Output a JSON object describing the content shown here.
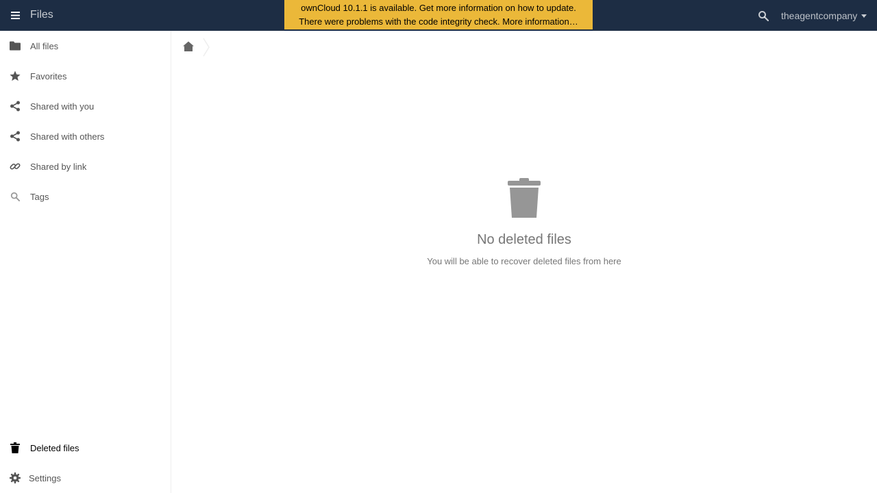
{
  "header": {
    "app_title": "Files",
    "menu_icon": "hamburger-icon",
    "notices": {
      "update": "ownCloud 10.1.1 is available. Get more information on how to update.",
      "integrity": "There were problems with the code integrity check. More information…"
    },
    "search_icon": "search-icon",
    "user": "theagentcompany",
    "bg_color": "#1d2d44",
    "notice_color": "#ebb839"
  },
  "sidebar": {
    "items": [
      {
        "label": "All files",
        "icon": "folder-icon"
      },
      {
        "label": "Favorites",
        "icon": "star-icon"
      },
      {
        "label": "Shared with you",
        "icon": "share-icon"
      },
      {
        "label": "Shared with others",
        "icon": "share-icon"
      },
      {
        "label": "Shared by link",
        "icon": "link-icon"
      },
      {
        "label": "Tags",
        "icon": "search-icon"
      }
    ],
    "deleted_files": {
      "label": "Deleted files",
      "icon": "trash-icon",
      "active": true
    },
    "settings": {
      "label": "Settings",
      "icon": "gear-icon"
    }
  },
  "breadcrumb": {
    "home_icon": "home-icon"
  },
  "empty_state": {
    "icon": "trash-icon",
    "title": "No deleted files",
    "hint": "You will be able to recover deleted files from here"
  }
}
